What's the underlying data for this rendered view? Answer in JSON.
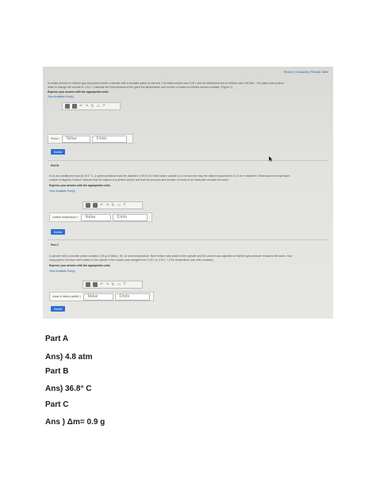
{
  "screen": {
    "header_links": "Review | Constants | Periodic Table",
    "part_a": {
      "problem_line1": "A certain amount of chlorine gas was placed inside a cylinder with a movable piston at one end. The initial volume was 3.00 L and the initial pressure of chlorine was 1.80 atm . The piston was pushed",
      "problem_line2": "down to change the volume to 1.00 L. Calculate the final pressure of the gas if the temperature and number of moles of chlorine remain constant. (Figure 1)",
      "instruction": "Express your answer with the appropriate units.",
      "hint": "View Available Hint(s)",
      "answer_label": "Pfinal =",
      "value_placeholder": "Value",
      "units_placeholder": "Units",
      "submit": "Submit"
    },
    "part_b": {
      "heading": "Part B",
      "problem_line1": "In an air-conditioned room at 19.0 °C, a spherical balloon had the diameter of 50.0 cm. When taken outside on a hot summer day, the balloon expanded to 51.0 cm in diameter. What was the temperature",
      "problem_line2": "outside in degrees Celsius? Assume that the balloon is a perfect sphere and that the pressure and number of moles of air molecules remains the same.",
      "instruction": "Express your answer with the appropriate units.",
      "hint": "View Available Hint(s)",
      "answer_label": "outside temperature =",
      "value_placeholder": "Value",
      "units_placeholder": "Units",
      "submit": "Submit"
    },
    "part_c": {
      "heading": "Part C",
      "problem_line1": "A cylinder with a movable piston contains 2.00 g of helium, He, at room temperature. More helium was added to the cylinder and the volume was adjusted so that the gas pressure remained the same. How",
      "problem_line2": "many grams of helium were added to the cylinder if the volume was changed from 2.00 L to 2.90 L ? (The temperature was held constant.)",
      "instruction": "Express your answer with the appropriate units.",
      "hint": "View Available Hint(s)",
      "answer_label": "mass of helium added =",
      "value_placeholder": "Value",
      "units_placeholder": "Units",
      "submit": "Submit"
    },
    "toolbar_glyphs": [
      "↶",
      "↷",
      "↻",
      "▭",
      "?"
    ]
  },
  "answers": {
    "part_a_label": "Part A",
    "part_a_answer": "Ans) 4.8 atm",
    "part_b_label": "Part B",
    "part_b_answer": "Ans) 36.8° C",
    "part_c_label": "Part C",
    "part_c_answer": "Ans ) Δm= 0.9 g"
  }
}
